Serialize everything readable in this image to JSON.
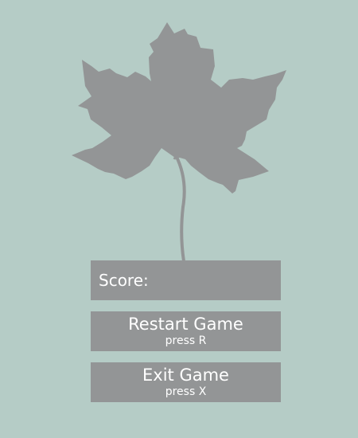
{
  "score": {
    "label": "Score:"
  },
  "buttons": {
    "restart": {
      "label": "Restart Game",
      "hint": "press R"
    },
    "exit": {
      "label": "Exit Game",
      "hint": "press X"
    }
  },
  "colors": {
    "background": "#b5ccc6",
    "panel": "#939596",
    "leaf": "#939596",
    "text": "#ffffff"
  },
  "icons": {
    "leaf": "maple-leaf-icon"
  }
}
